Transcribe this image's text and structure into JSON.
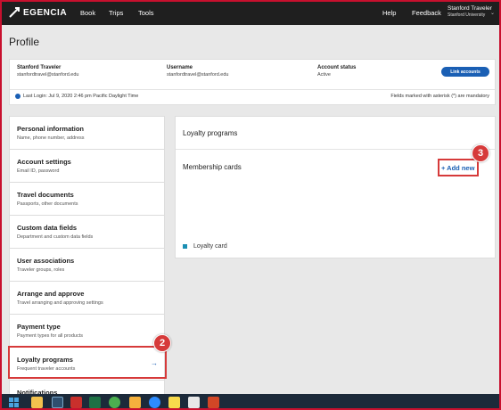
{
  "app": {
    "logo": "EGENCIA",
    "nav": [
      "Book",
      "Trips",
      "Tools"
    ],
    "help": "Help",
    "feedback": "Feedback",
    "user_name": "Stanford Traveler",
    "user_org": "Stanford University"
  },
  "page_title": "Profile",
  "account": {
    "name_label": "Stanford Traveler",
    "name_email": "stanfordtravel@stanford.edu",
    "username_label": "Username",
    "username_value": "stanfordtravel@stanford.edu",
    "status_label": "Account status",
    "status_value": "Active",
    "link_button": "Link accounts",
    "last_login": "Last Login: Jul 9, 2020 2:46 pm Pacific Daylight Time",
    "mandatory_note": "Fields marked with asterisk (*) are mandatory"
  },
  "sidebar": {
    "items": [
      {
        "title": "Personal information",
        "sub": "Name, phone number, address"
      },
      {
        "title": "Account settings",
        "sub": "Email ID, password"
      },
      {
        "title": "Travel documents",
        "sub": "Passports, other documents"
      },
      {
        "title": "Custom data fields",
        "sub": "Department and custom data fields"
      },
      {
        "title": "User associations",
        "sub": "Traveler groups, roles"
      },
      {
        "title": "Arrange and approve",
        "sub": "Travel arranging and approving settings"
      },
      {
        "title": "Payment type",
        "sub": "Payment types for all products"
      },
      {
        "title": "Loyalty programs",
        "sub": "Frequent traveler accounts",
        "arrow": "→"
      },
      {
        "title": "Notifications",
        "sub": ""
      }
    ]
  },
  "panel": {
    "title": "Loyalty programs",
    "subtitle": "Membership cards",
    "add_new": "+ Add new",
    "legend": "Loyalty card"
  },
  "callouts": {
    "two": "2",
    "three": "3"
  },
  "colors": {
    "accent": "#1a5fb4",
    "callout": "#d63a3a",
    "navbar": "#1f1f1f",
    "taskbar": "#1c2a3a"
  },
  "taskbar": {
    "icons": [
      "windows-start-icon",
      "file-explorer-icon",
      "calculator-icon",
      "acrobat-icon",
      "excel-icon",
      "chrome-icon",
      "photo-icon",
      "zoom-icon",
      "sticky-notes-icon",
      "camera-icon",
      "powerpoint-icon"
    ]
  }
}
